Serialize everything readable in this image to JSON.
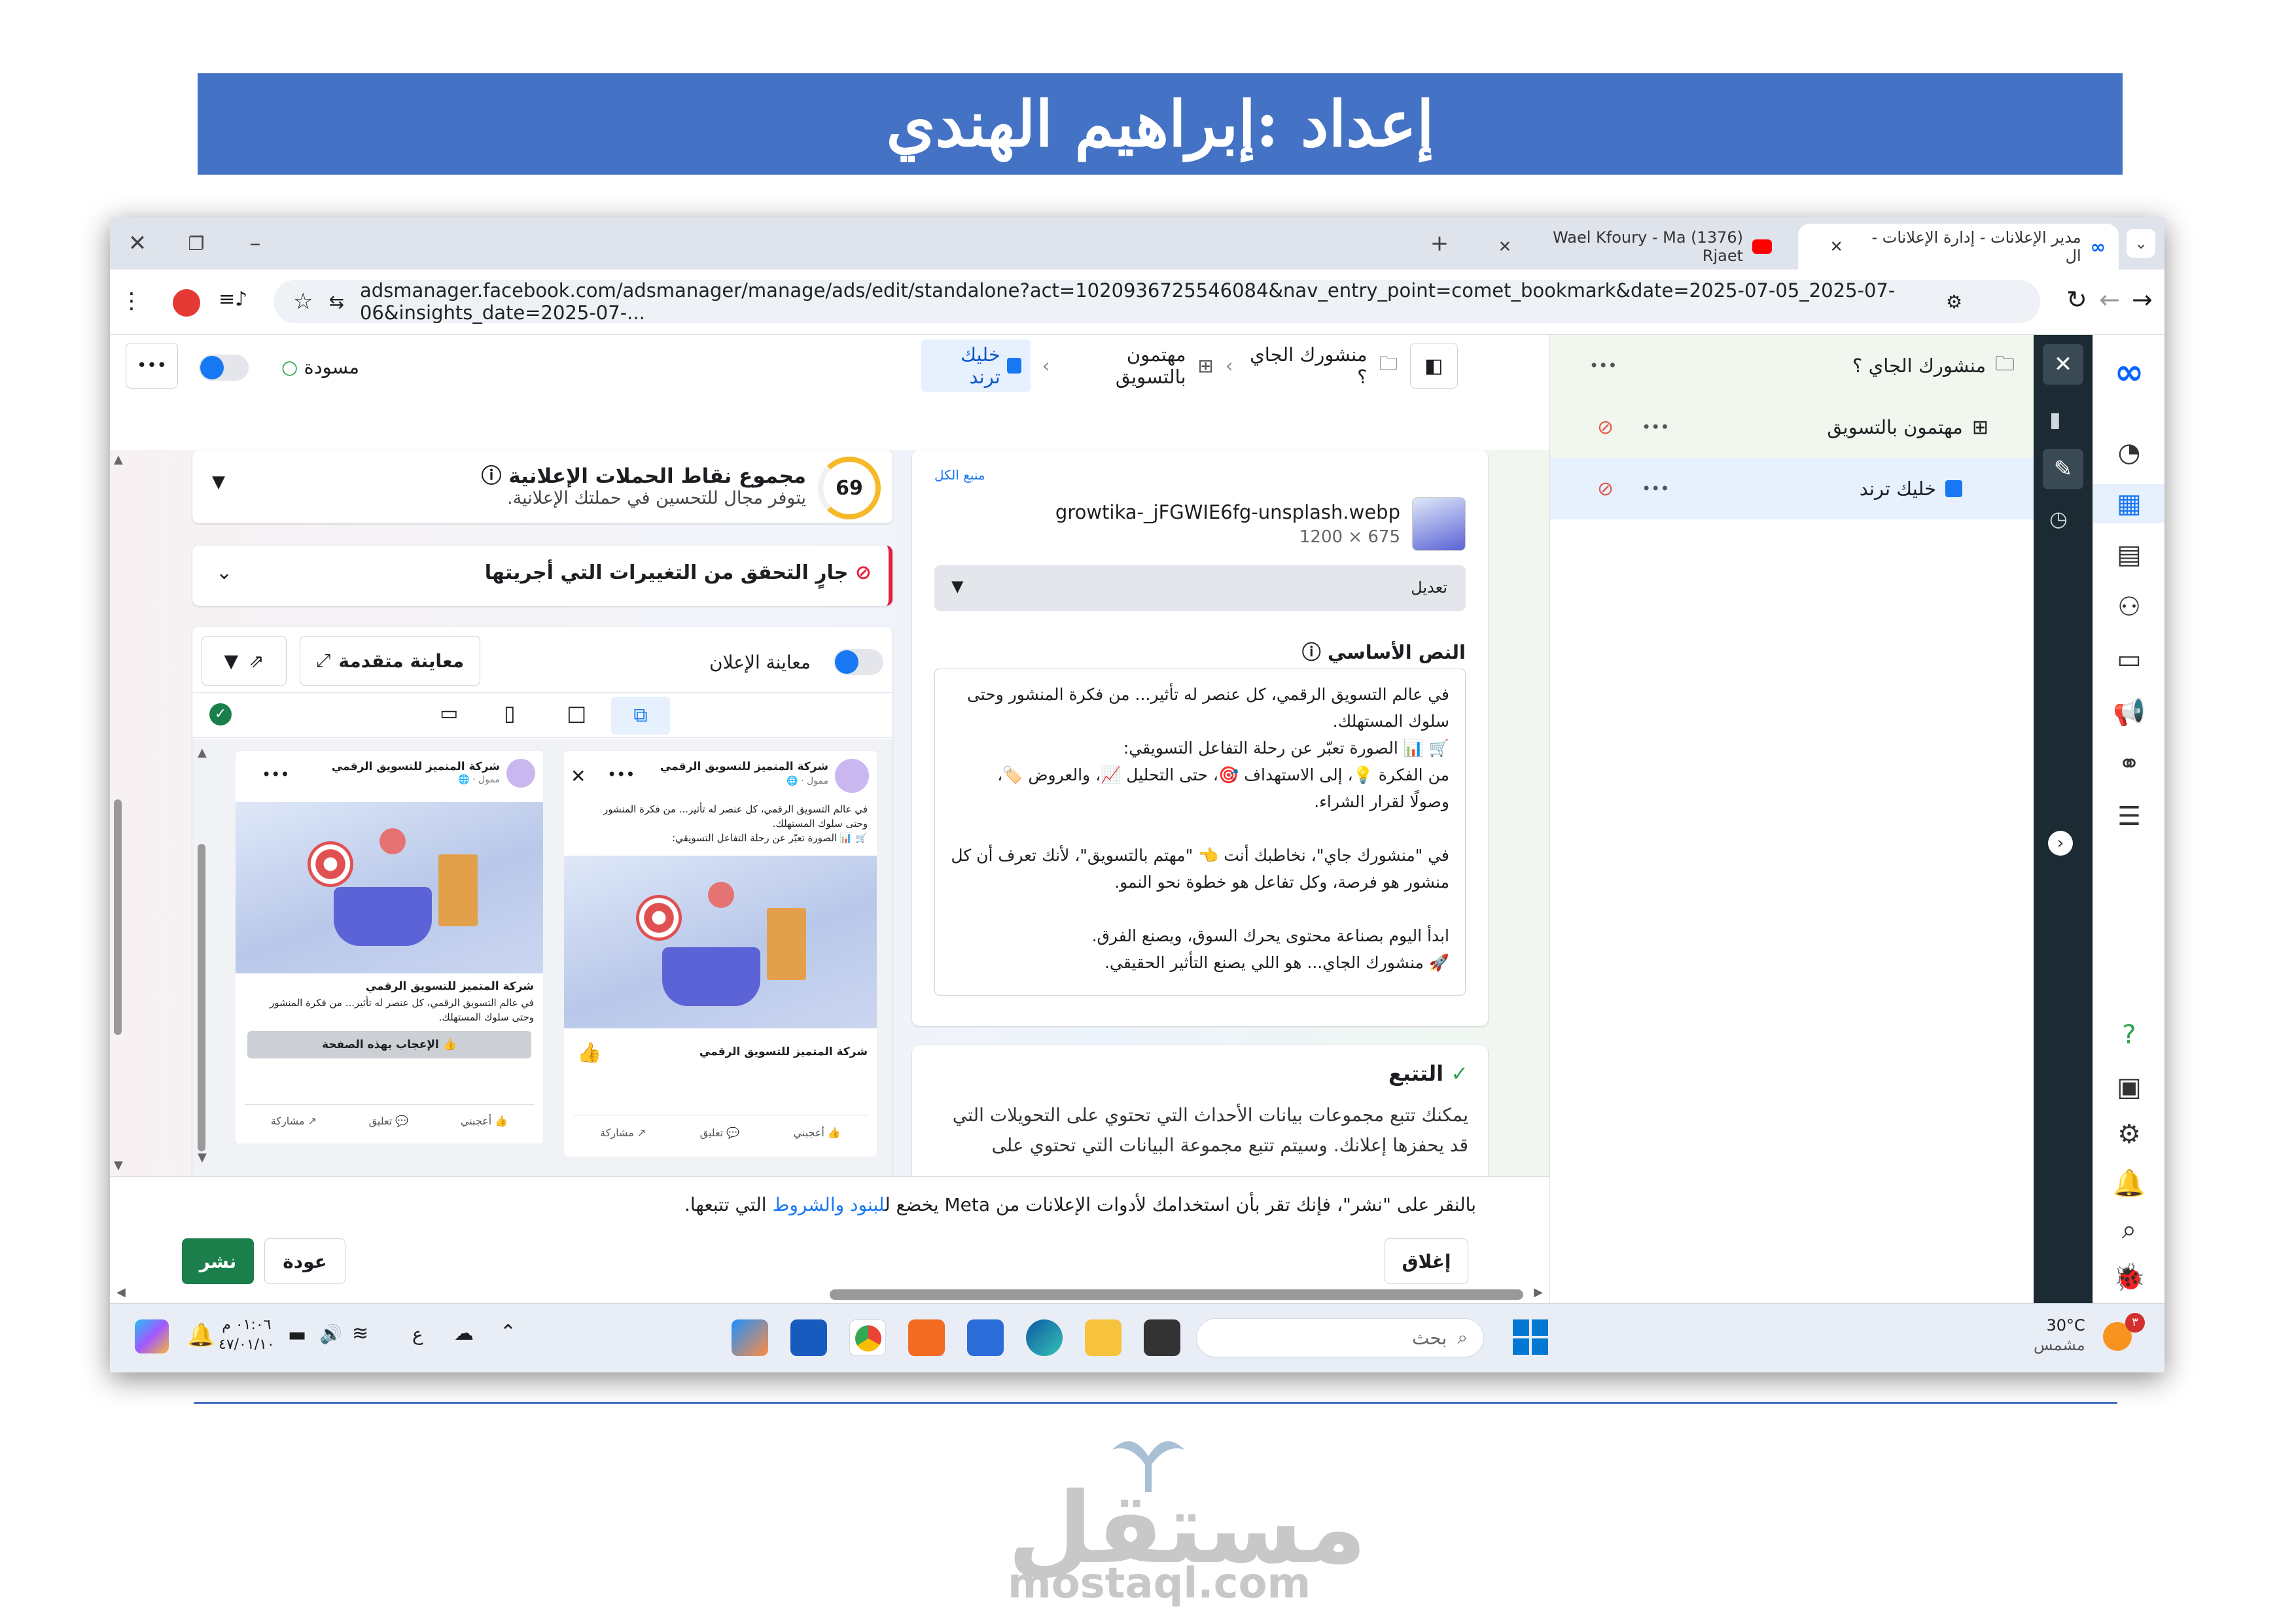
{
  "banner": {
    "title": "إعداد :إبراهيم الهندي"
  },
  "browser": {
    "tabs": [
      {
        "label": "مدير الإعلانات - إدارة الإعلانات - ال",
        "active": true
      },
      {
        "label": "(1376) Wael Kfoury - Ma Rjaet",
        "active": false
      }
    ],
    "new_tab": "+",
    "url": "adsmanager.facebook.com/adsmanager/manage/ads/edit/standalone?act=1020936725546084&nav_entry_point=comet_bookmark&date=2025-07-05_2025-07-06&insights_date=2025-07-..."
  },
  "topbar": {
    "draft_label": "مسودة",
    "more": "•••",
    "breadcrumb": [
      "منشورك الجاي ؟",
      "مهتمون بالتسويق",
      "خليك ترند"
    ]
  },
  "sidebar": {
    "campaign": "منشورك الجاي ؟",
    "adset": "مهتمون بالتسويق",
    "ad": "خليك ترند",
    "more": "•••"
  },
  "media": {
    "link": "منبع الكل",
    "filename": "growtika-_jFGWIE6fg-unsplash.webp",
    "dims": "675 × 1200",
    "edit_label": "تعديل"
  },
  "primary_text": {
    "title": "النص الأساسي",
    "lines": [
      "في عالم التسويق الرقمي، كل عنصر له تأثير... من فكرة المنشور وحتى",
      "سلوك المستهلك.",
      "🛒 📊 الصورة تعبّر عن رحلة التفاعل التسويقي:",
      "من الفكرة 💡، إلى الاستهداف 🎯، حتى التحليل 📈، والعروض 🏷️،",
      "وصولًا لقرار الشراء.",
      "",
      "في \"منشورك جاي\"، نخاطبك أنت 👈 \"مهتم بالتسويق\"، لأنك تعرف أن كل",
      "منشور هو فرصة، وكل تفاعل هو خطوة نحو النمو.",
      "",
      "ابدأ اليوم بصناعة محتوى يحرك السوق، ويصنع الفرق.",
      "🚀 منشورك الجاي... هو اللي يصنع التأثير الحقيقي."
    ]
  },
  "tracking": {
    "title": "التتبع",
    "text1": "يمكنك تتبع مجموعات بيانات الأحداث التي تحتوي على التحويلات التي",
    "text2": "قد يحفزها إعلانك. وسيتم تتبع مجموعة البيانات التي تحتوي على"
  },
  "score": {
    "value": "69",
    "value_num": 69,
    "title": "مجموع نقاط الحملات الإعلانية",
    "subtitle": "يتوفر مجال للتحسين في حملتك الإعلانية."
  },
  "checking": {
    "label": "جارٍ التحقق من التغييرات التي أجريتها"
  },
  "preview": {
    "toggle_label": "معاينة الإعلان",
    "advanced": "معاينة متقدمة",
    "page_name": "شركة المتميز للتسويق الرقمي",
    "sponsored": "ممول · 🌐",
    "text_short1": "في عالم التسويق الرقمي، كل عنصر له تأثير... من فكرة المنشور",
    "text_short2": "وحتى سلوك المستهلك.",
    "text_short3": "🛒 📊 الصورة تعبّر عن رحلة التفاعل التسويقي:",
    "like_page": "الإعجاب بهذه الصفحة",
    "actions": [
      "أعجبني",
      "تعليق",
      "مشاركة"
    ]
  },
  "footer": {
    "terms_pre": "بالنقر على \"نشر\"، فإنك تقر بأن استخدامك لأدوات الإعلانات من Meta يخضع ل",
    "terms_link": "لبنود والشروط",
    "terms_post": " التي تتبعها.",
    "close": "إغلاق",
    "back": "عودة",
    "publish": "نشر"
  },
  "taskbar": {
    "search_placeholder": "بحث",
    "temp": "30°C",
    "weather": "مشمس",
    "time": "٠١:٠٦ م",
    "date": "٤٧/٠١/١٠",
    "lang": "ع",
    "notif_count": "٣"
  },
  "watermark": {
    "brand": "مستقل",
    "domain": "mostaql.com"
  },
  "colors": {
    "banner": "#4472c4",
    "publish": "#1b7f4b",
    "toggle": "#1877f2",
    "dark_rail": "#1c2b33"
  }
}
